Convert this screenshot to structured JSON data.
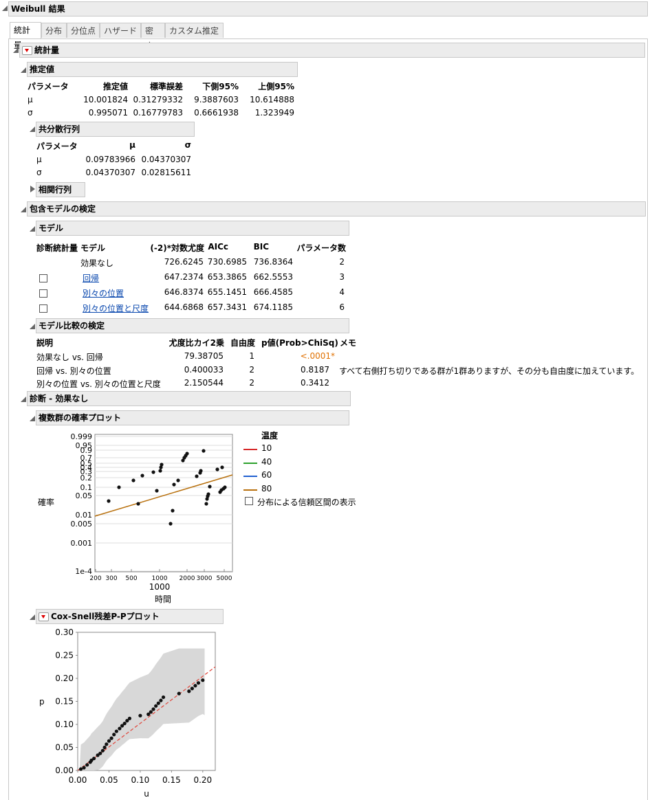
{
  "title": "Weibull 結果",
  "tabs": [
    "統計量",
    "分布",
    "分位点",
    "ハザード",
    "密度",
    "カスタム推定"
  ],
  "sec_stats": "統計量",
  "estimates": {
    "title": "推定値",
    "headers": [
      "パラメータ",
      "推定値",
      "標準誤差",
      "下側95%",
      "上側95%"
    ],
    "rows": [
      [
        "μ",
        "10.001824",
        "0.31279332",
        "9.3887603",
        "10.614888"
      ],
      [
        "σ",
        "0.995071",
        "0.16779783",
        "0.6661938",
        "1.323949"
      ]
    ]
  },
  "cov": {
    "title": "共分散行列",
    "headers": [
      "パラメータ",
      "μ",
      "σ"
    ],
    "rows": [
      [
        "μ",
        "0.09783966",
        "0.04370307"
      ],
      [
        "σ",
        "0.04370307",
        "0.02815611"
      ]
    ]
  },
  "corr_title": "相関行列",
  "nested_title": "包含モデルの検定",
  "model": {
    "title": "モデル",
    "headers": [
      "診断統計量",
      "モデル",
      "(-2)*対数尤度",
      "AICc",
      "BIC",
      "パラメータ数"
    ],
    "rows": [
      {
        "name": "効果なし",
        "ll": "726.6245",
        "aicc": "730.6985",
        "bic": "736.8364",
        "k": "2"
      },
      {
        "name": "回帰",
        "ll": "647.2374",
        "aicc": "653.3865",
        "bic": "662.5553",
        "k": "3"
      },
      {
        "name": "別々の位置",
        "ll": "646.8374",
        "aicc": "655.1451",
        "bic": "666.4585",
        "k": "4"
      },
      {
        "name": "別々の位置と尺度",
        "ll": "644.6868",
        "aicc": "657.3431",
        "bic": "674.1185",
        "k": "6"
      }
    ]
  },
  "compare": {
    "title": "モデル比較の検定",
    "headers": [
      "説明",
      "尤度比カイ2乗",
      "自由度",
      "p値(Prob>ChiSq)",
      "メモ"
    ],
    "rows": [
      {
        "desc": "効果なし vs. 回帰",
        "chi": "79.38705",
        "df": "1",
        "p": "<.0001*",
        "memo": ""
      },
      {
        "desc": "回帰 vs. 別々の位置",
        "chi": "0.400033",
        "df": "2",
        "p": "0.8187",
        "memo": "すべて右側打ち切りである群が1群ありますが、その分も自由度に加えています。"
      },
      {
        "desc": "別々の位置 vs. 別々の位置と尺度",
        "chi": "2.150544",
        "df": "2",
        "p": "0.3412",
        "memo": ""
      }
    ]
  },
  "diag_title": "診断 - 効果なし",
  "prob_title": "複数群の確率プロット",
  "prob_plot": {
    "ylabel": "確率",
    "xlabel": "時間",
    "yticks": [
      "0.999",
      "0.95",
      "0.9",
      "0.7",
      "0.5",
      "0.4",
      "0.3",
      "0.2",
      "0.1",
      "0.05",
      "0.01",
      "0.005",
      "0.001",
      "1e-4"
    ],
    "xticks": [
      "200",
      "300",
      "500",
      "1000",
      "2000",
      "3000",
      "5000"
    ],
    "xtick_big": "1000",
    "legend_title": "温度",
    "legend": [
      {
        "label": "10",
        "color": "#d62728"
      },
      {
        "label": "40",
        "color": "#2ca02c"
      },
      {
        "label": "60",
        "color": "#1f5fd0"
      },
      {
        "label": "80",
        "color": "#b8700d"
      }
    ],
    "ci_label": "分布による信頼区間の表示"
  },
  "cs_title": "Cox-Snell残差P-Pプロット",
  "chart_data": {
    "type": "scatter",
    "title": "Cox-Snell残差P-Pプロット",
    "xlabel": "u",
    "ylabel": "p",
    "xlim": [
      0,
      0.22
    ],
    "ylim": [
      0,
      0.3
    ],
    "xticks": [
      "0.00",
      "0.05",
      "0.10",
      "0.15",
      "0.20"
    ],
    "yticks": [
      "0.00",
      "0.05",
      "0.10",
      "0.15",
      "0.20",
      "0.25",
      "0.30"
    ],
    "points": [
      [
        0.005,
        0.003
      ],
      [
        0.01,
        0.006
      ],
      [
        0.015,
        0.012
      ],
      [
        0.02,
        0.018
      ],
      [
        0.022,
        0.022
      ],
      [
        0.026,
        0.026
      ],
      [
        0.032,
        0.033
      ],
      [
        0.036,
        0.037
      ],
      [
        0.04,
        0.043
      ],
      [
        0.043,
        0.05
      ],
      [
        0.046,
        0.057
      ],
      [
        0.05,
        0.064
      ],
      [
        0.054,
        0.07
      ],
      [
        0.058,
        0.078
      ],
      [
        0.062,
        0.085
      ],
      [
        0.067,
        0.091
      ],
      [
        0.071,
        0.097
      ],
      [
        0.075,
        0.102
      ],
      [
        0.079,
        0.108
      ],
      [
        0.083,
        0.113
      ],
      [
        0.1,
        0.119
      ],
      [
        0.113,
        0.122
      ],
      [
        0.117,
        0.127
      ],
      [
        0.121,
        0.133
      ],
      [
        0.125,
        0.14
      ],
      [
        0.129,
        0.146
      ],
      [
        0.133,
        0.152
      ],
      [
        0.137,
        0.159
      ],
      [
        0.162,
        0.167
      ],
      [
        0.178,
        0.172
      ],
      [
        0.183,
        0.178
      ],
      [
        0.188,
        0.184
      ],
      [
        0.193,
        0.19
      ],
      [
        0.2,
        0.196
      ]
    ]
  }
}
